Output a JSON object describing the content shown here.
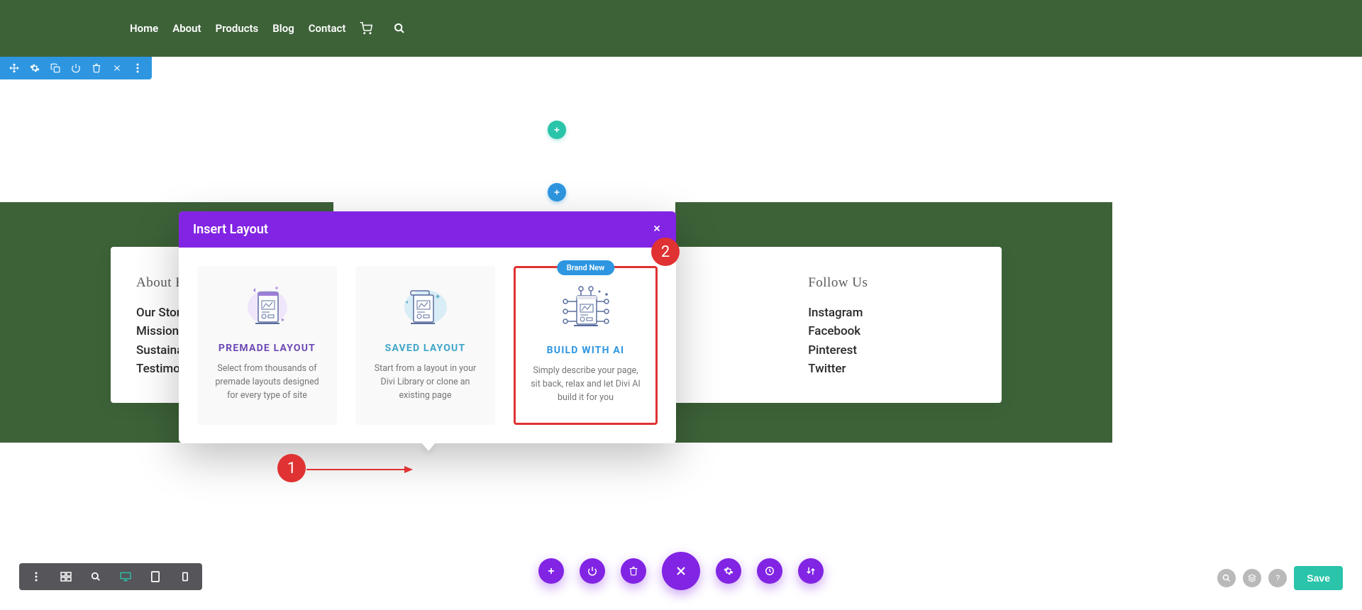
{
  "nav": {
    "items": [
      "Home",
      "About",
      "Products",
      "Blog",
      "Contact"
    ]
  },
  "modal": {
    "title": "Insert Layout",
    "cards": [
      {
        "title": "PREMADE LAYOUT",
        "desc": "Select from thousands of premade layouts designed for every type of site"
      },
      {
        "title": "SAVED LAYOUT",
        "desc": "Start from a layout in your Divi Library or clone an existing page"
      },
      {
        "title": "BUILD WITH AI",
        "desc": "Simply describe your page, sit back, relax and let Divi AI build it for you",
        "badge": "Brand New"
      }
    ]
  },
  "footer": {
    "col1_title": "About H",
    "col1_items": [
      "Our Stor",
      "Mission",
      "Sustaina",
      "Testimor"
    ],
    "col2_title": "Follow Us",
    "col2_items": [
      "Instagram",
      "Facebook",
      "Pinterest",
      "Twitter"
    ]
  },
  "annotations": {
    "b1": "1",
    "b2": "2"
  },
  "buttons": {
    "save": "Save"
  },
  "colors": {
    "header": "#3d6238",
    "purple": "#8224e3",
    "teal": "#29c4a9",
    "blue": "#2e96e0",
    "red": "#e03232"
  }
}
